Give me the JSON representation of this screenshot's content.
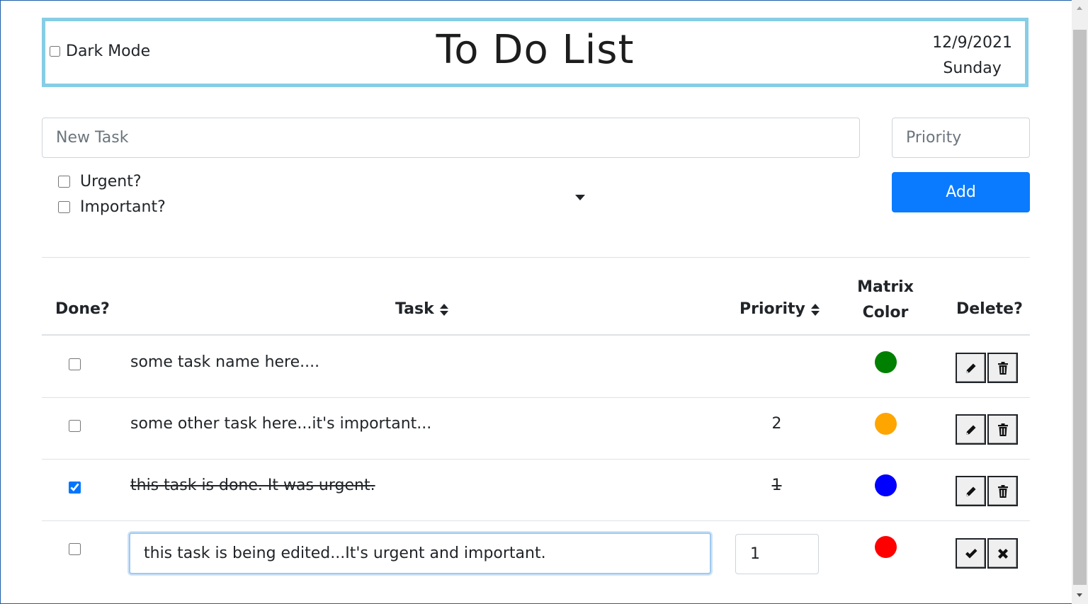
{
  "header": {
    "dark_mode_label": "Dark Mode",
    "title": "To Do List",
    "date": "12/9/2021",
    "day": "Sunday",
    "border_color": "#87cde6"
  },
  "form": {
    "new_task_placeholder": "New Task",
    "priority_placeholder": "Priority",
    "urgent_label": "Urgent?",
    "important_label": "Important?",
    "add_label": "Add",
    "add_color": "#0a7bff"
  },
  "table": {
    "headers": {
      "done": "Done?",
      "task": "Task",
      "priority": "Priority",
      "matrix_line1": "Matrix",
      "matrix_line2": "Color",
      "delete": "Delete?"
    },
    "rows": [
      {
        "task": "some task name here....",
        "priority": "",
        "done": false,
        "color": "#008000",
        "mode": "view"
      },
      {
        "task": "some other task here...it's important...",
        "priority": "2",
        "done": false,
        "color": "#ffa500",
        "mode": "view"
      },
      {
        "task": "this task is done. It was urgent.",
        "priority": "1",
        "done": true,
        "color": "#0000ff",
        "mode": "view"
      },
      {
        "task": "this task is being edited...It's urgent and important.",
        "priority": "1",
        "done": false,
        "color": "#ff0000",
        "mode": "edit"
      }
    ]
  },
  "icons": {
    "sort": "sort-icon",
    "edit": "pencil-icon",
    "delete": "trash-icon",
    "save": "check-icon",
    "cancel": "x-icon"
  }
}
